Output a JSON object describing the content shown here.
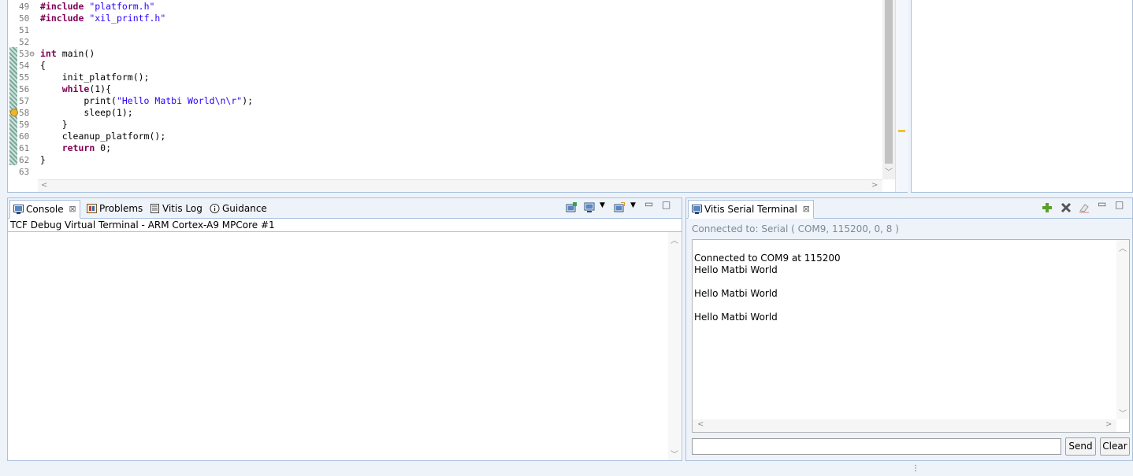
{
  "editor": {
    "lines": [
      {
        "num": "49",
        "code": "#include \"platform.h\""
      },
      {
        "num": "50",
        "code": "#include \"xil_printf.h\""
      },
      {
        "num": "51",
        "code": ""
      },
      {
        "num": "52",
        "code": ""
      },
      {
        "num": "53⊖",
        "code": "int main()"
      },
      {
        "num": "54",
        "code": "{"
      },
      {
        "num": "55",
        "code": "    init_platform();"
      },
      {
        "num": "56",
        "code": "    while(1){"
      },
      {
        "num": "57",
        "code": "        print(\"Hello Matbi World\\n\\r\");"
      },
      {
        "num": "58",
        "code": "        sleep(1);"
      },
      {
        "num": "59",
        "code": "    }"
      },
      {
        "num": "60",
        "code": "    cleanup_platform();"
      },
      {
        "num": "61",
        "code": "    return 0;"
      },
      {
        "num": "62",
        "code": "}"
      },
      {
        "num": "63",
        "code": ""
      }
    ]
  },
  "console": {
    "tabs": [
      {
        "label": "Console",
        "icon": "console-icon"
      },
      {
        "label": "Problems",
        "icon": "problems-icon"
      },
      {
        "label": "Vitis Log",
        "icon": "log-icon"
      },
      {
        "label": "Guidance",
        "icon": "info-icon"
      }
    ],
    "title": "TCF Debug Virtual Terminal - ARM Cortex-A9 MPCore #1"
  },
  "serial": {
    "tab_label": "Vitis Serial Terminal",
    "status": "Connected to: Serial (  COM9, 115200, 0, 8 )",
    "output": [
      "Connected to COM9 at 115200",
      "Hello Matbi World",
      "",
      "Hello Matbi World",
      "",
      "Hello Matbi World"
    ],
    "input_value": "",
    "send_label": "Send",
    "clear_label": "Clear"
  },
  "colors": {
    "keyword": "#7f0055",
    "string": "#2a00ff",
    "panel_border": "#a9c1de"
  }
}
